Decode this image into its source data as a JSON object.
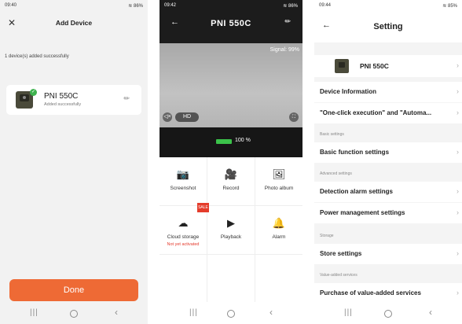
{
  "add_device": {
    "status_time": "09:40",
    "status_right": "86%",
    "title": "Add Device",
    "message": "1 device(s) added successfully",
    "device_name": "PNI 550C",
    "device_status": "Added successfully",
    "done_label": "Done",
    "icons": {
      "close": "close-icon",
      "check": "check-icon",
      "edit": "pencil-icon"
    }
  },
  "camera": {
    "status_time": "09:42",
    "status_right": "86%",
    "title": "PNI 550C",
    "signal": "Signal: 99%",
    "quality": "HD",
    "battery_text": "100 %",
    "battery_level": 1.0,
    "sale_badge": "SALE",
    "tiles": [
      {
        "label": "Screenshot",
        "sub": "",
        "icon": "camera-icon",
        "glyph": "📷"
      },
      {
        "label": "Record",
        "sub": "",
        "icon": "video-icon",
        "glyph": "🎥"
      },
      {
        "label": "Photo album",
        "sub": "",
        "icon": "image-icon",
        "glyph": "🖼"
      },
      {
        "label": "Cloud storage",
        "sub": "Not yet activated",
        "icon": "cloud-icon",
        "glyph": "☁"
      },
      {
        "label": "Playback",
        "sub": "",
        "icon": "playback-icon",
        "glyph": "▶"
      },
      {
        "label": "Alarm",
        "sub": "",
        "icon": "alarm-icon",
        "glyph": "🔔"
      }
    ]
  },
  "settings": {
    "status_time": "09:44",
    "status_right": "85%",
    "title": "Setting",
    "device_name": "PNI 550C",
    "rows": {
      "device_info": "Device Information",
      "one_click": "\"One-click execution\" and \"Automa...",
      "basic_function": "Basic function settings",
      "detection_alarm": "Detection alarm settings",
      "power_management": "Power management settings",
      "store": "Store settings",
      "value_added": "Purchase of value-added services"
    },
    "sections": {
      "basic": "Basic settings",
      "advanced": "Advanced settings",
      "storage": "Storage",
      "value_added": "Value-added services"
    }
  },
  "accent": {
    "orange": "#ee6a35",
    "green": "#3bc24a",
    "red": "#e43c2b"
  }
}
